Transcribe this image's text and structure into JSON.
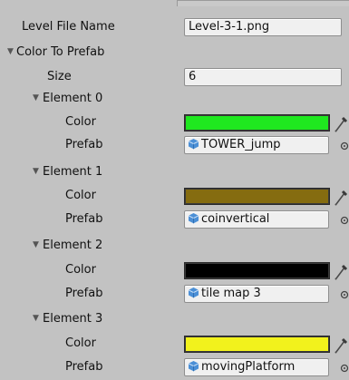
{
  "inspector": {
    "level_file_name": {
      "label": "Level File Name",
      "value": "Level-3-1.png"
    },
    "color_to_prefab": {
      "label": "Color To Prefab",
      "size": {
        "label": "Size",
        "value": "6"
      },
      "elements": [
        {
          "label": "Element 0",
          "color_label": "Color",
          "color": "#1fe81f",
          "prefab_label": "Prefab",
          "prefab": "TOWER_jump"
        },
        {
          "label": "Element 1",
          "color_label": "Color",
          "color": "#856c10",
          "prefab_label": "Prefab",
          "prefab": "coinvertical"
        },
        {
          "label": "Element 2",
          "color_label": "Color",
          "color": "#000000",
          "prefab_label": "Prefab",
          "prefab": "tile map 3"
        },
        {
          "label": "Element 3",
          "color_label": "Color",
          "color": "#f2f21c",
          "prefab_label": "Prefab",
          "prefab": "movingPlatform"
        }
      ]
    }
  },
  "icons": {
    "foldout": "triangle-down-icon",
    "eyedropper": "eyedropper-icon",
    "prefab": "prefab-cube-icon",
    "object_picker": "object-picker-circle-icon"
  },
  "colors": {
    "background": "#c2c2c2",
    "field_background": "#f0f0f0",
    "prefab_icon": "#4b8fd6"
  }
}
